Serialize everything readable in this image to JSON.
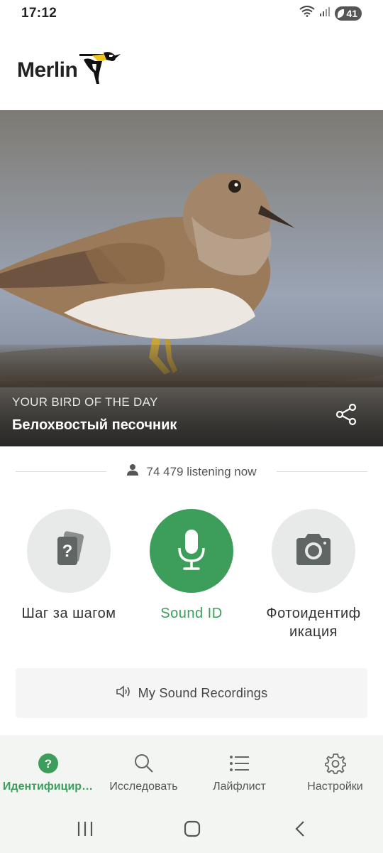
{
  "status_bar": {
    "time": "17:12",
    "battery": "41"
  },
  "app": {
    "logo_text": "Merlin",
    "logo_mark": "®"
  },
  "bird_of_day": {
    "kicker": "YOUR BIRD OF THE DAY",
    "name": "Белохвостый песочник"
  },
  "listeners": {
    "count_text": "74 479 listening now"
  },
  "actions": [
    {
      "label": "Шаг за шагом",
      "icon": "question-cards-icon"
    },
    {
      "label": "Sound ID",
      "icon": "microphone-icon"
    },
    {
      "label": "Фотоидентиф икация",
      "icon": "camera-icon"
    }
  ],
  "recordings": {
    "label": "My Sound Recordings"
  },
  "nav": [
    {
      "label": "Идентифицир…",
      "icon": "question-circle-icon"
    },
    {
      "label": "Исследовать",
      "icon": "search-icon"
    },
    {
      "label": "Лайфлист",
      "icon": "list-icon"
    },
    {
      "label": "Настройки",
      "icon": "gear-icon"
    }
  ],
  "colors": {
    "accent": "#3c9e5a",
    "circle_bg": "#e8eae9"
  }
}
